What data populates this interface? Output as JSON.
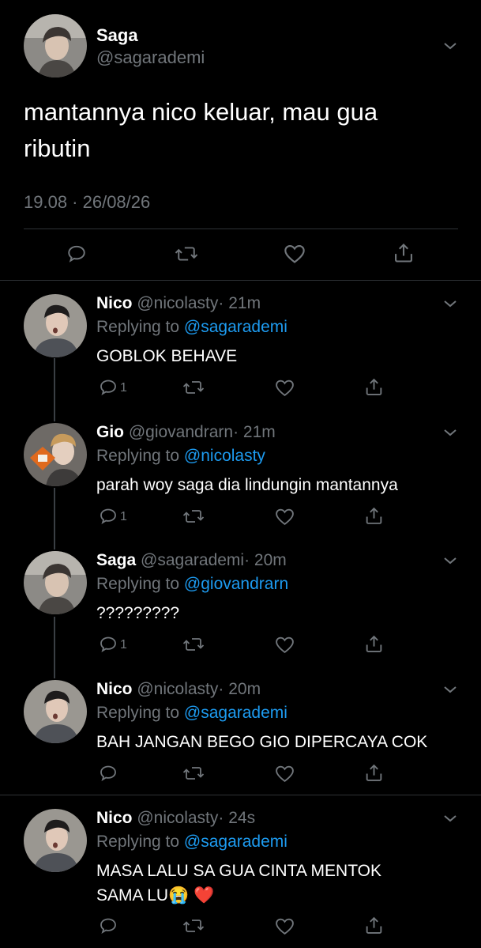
{
  "main_tweet": {
    "name": "Saga",
    "handle": "@sagarademi",
    "text_line1": "mantannya nico keluar, mau gua",
    "text_line2": "ributin",
    "timestamp": "19.08 · 26/08/26"
  },
  "replies": [
    {
      "name": "Nico",
      "handle": "@nicolasty",
      "time": "· 21m",
      "replying_label": "Replying to",
      "replying_to": "@sagarademi",
      "text": "GOBLOK BEHAVE",
      "reply_count": "1"
    },
    {
      "name": "Gio",
      "handle": "@giovandrarn",
      "time": "· 21m",
      "replying_label": "Replying to",
      "replying_to": "@nicolasty",
      "text": "parah woy saga dia lindungin mantannya",
      "reply_count": "1"
    },
    {
      "name": "Saga",
      "handle": "@sagarademi",
      "time": "· 20m",
      "replying_label": "Replying to",
      "replying_to": "@giovandrarn",
      "text": "?????????",
      "reply_count": "1"
    },
    {
      "name": "Nico",
      "handle": "@nicolasty",
      "time": "· 20m",
      "replying_label": "Replying to",
      "replying_to": "@sagarademi",
      "text": "BAH JANGAN BEGO GIO DIPERCAYA COK",
      "reply_count": ""
    },
    {
      "name": "Nico",
      "handle": "@nicolasty",
      "time": "· 24s",
      "replying_label": "Replying to",
      "replying_to": "@sagarademi",
      "text_line1": "MASA LALU SA GUA CINTA MENTOK",
      "text_line2": "SAMA LU",
      "emoji1": "😭",
      "emoji2": "❤️",
      "reply_count": ""
    }
  ],
  "colors": {
    "background": "#000000",
    "text": "#ffffff",
    "muted": "#71767b",
    "link": "#1d9bf0",
    "divider": "#2f3336"
  },
  "icons": [
    "reply-icon",
    "retweet-icon",
    "like-icon",
    "share-icon",
    "chevron-down-icon"
  ]
}
